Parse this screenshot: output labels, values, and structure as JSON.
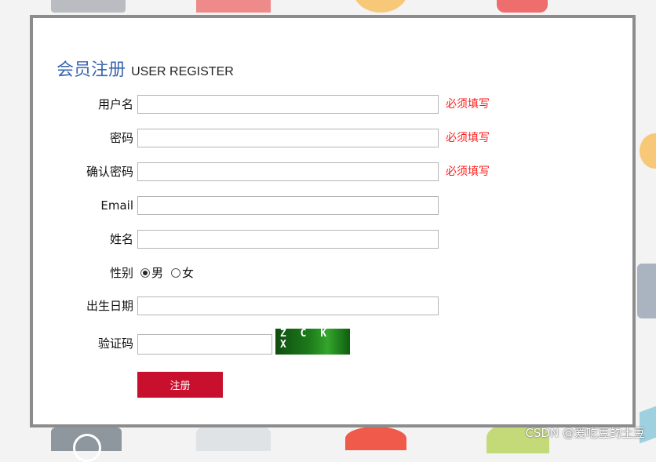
{
  "title": {
    "cn": "会员注册",
    "en": "USER REGISTER"
  },
  "fields": {
    "username": {
      "label": "用户名",
      "required": "必须填写"
    },
    "password": {
      "label": "密码",
      "required": "必须填写"
    },
    "confirm": {
      "label": "确认密码",
      "required": "必须填写"
    },
    "email": {
      "label": "Email"
    },
    "name": {
      "label": "姓名"
    },
    "gender": {
      "label": "性别",
      "male": "男",
      "female": "女",
      "selected": "男"
    },
    "birthday": {
      "label": "出生日期"
    },
    "captcha": {
      "label": "验证码",
      "code": "Z C K X"
    }
  },
  "submit_label": "注册",
  "watermark": "CSDN @爱吃豆的土豆",
  "colors": {
    "accent": "#c8102e",
    "title": "#3a66b0",
    "required": "#ff1a1a"
  }
}
